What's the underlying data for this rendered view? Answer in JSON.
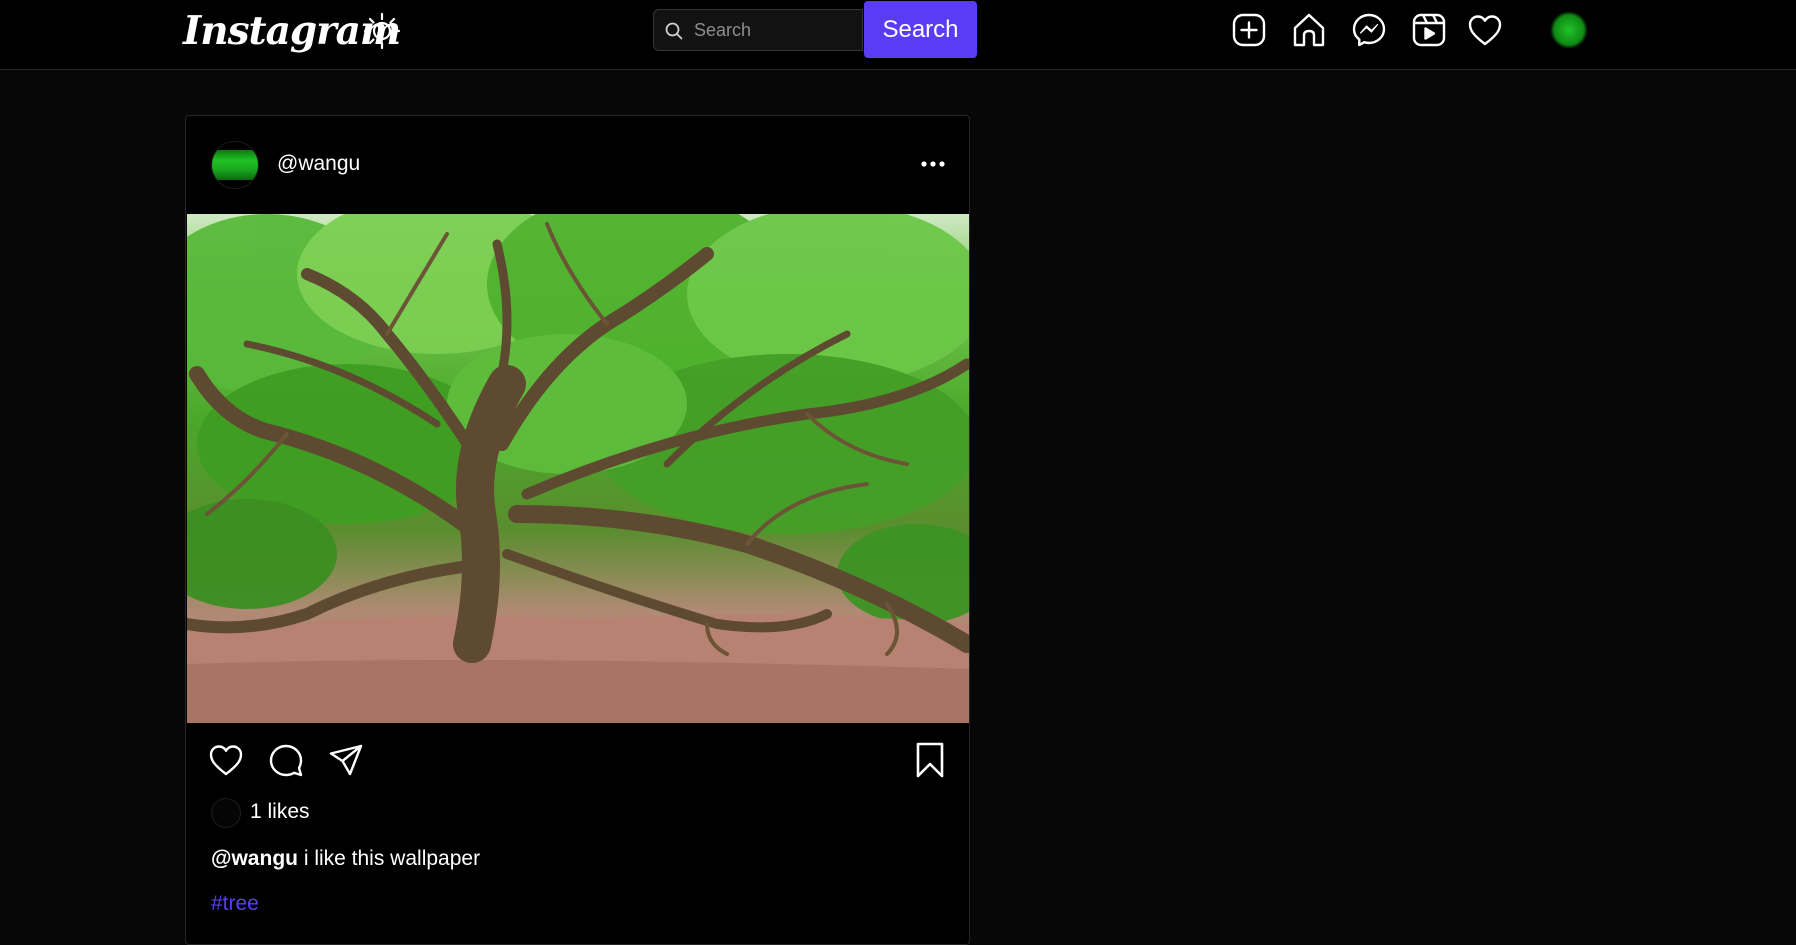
{
  "header": {
    "logo": "Instagram",
    "theme_icon": "sun-icon",
    "search": {
      "placeholder": "Search",
      "value": "",
      "button_label": "Search"
    },
    "nav_icons": [
      "plus-square-icon",
      "home-icon",
      "messenger-icon",
      "reels-icon",
      "heart-icon"
    ],
    "accent_color": "#5b3cf5"
  },
  "post": {
    "username": "@wangu",
    "image_icon": "photo-image",
    "likes": "1 likes",
    "caption_user": "@wangu",
    "caption_text": " i like this wallpaper",
    "hashtag": "#tree",
    "actions": [
      "heart-icon",
      "comment-icon",
      "share-icon",
      "bookmark-icon"
    ]
  }
}
